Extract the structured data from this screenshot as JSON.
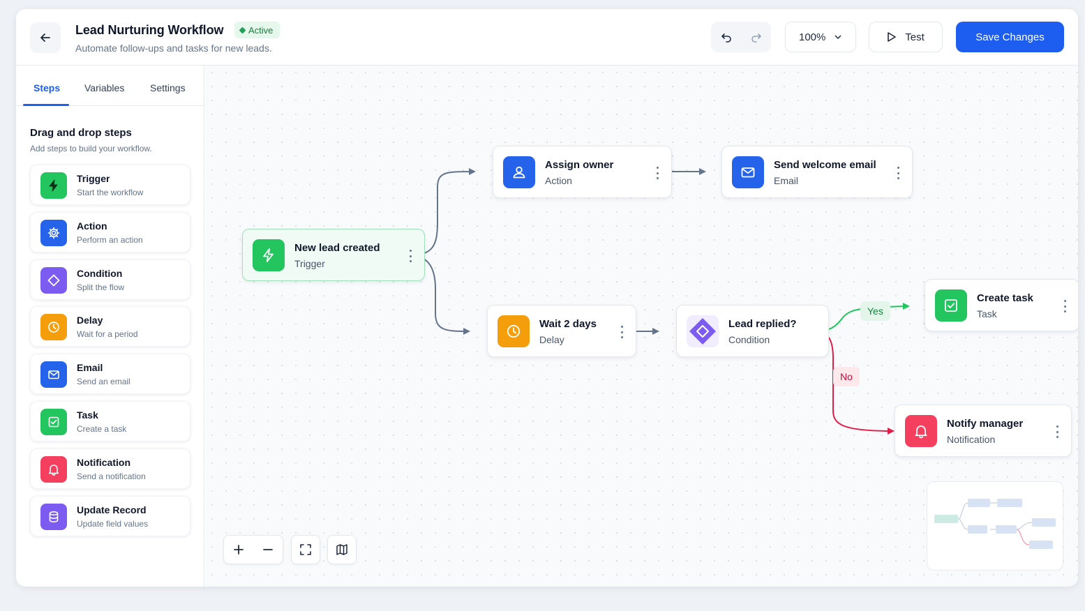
{
  "header": {
    "title": "Lead Nurturing Workflow",
    "status": "Active",
    "subtitle": "Automate follow-ups and tasks for new leads.",
    "zoom": "100%",
    "test_label": "Test",
    "save_label": "Save Changes",
    "icons": [
      "back-arrow-icon",
      "undo-icon",
      "redo-icon",
      "chevron-down-icon",
      "play-icon"
    ]
  },
  "sidebar": {
    "tabs": [
      {
        "label": "Steps",
        "active": true
      },
      {
        "label": "Variables",
        "active": false
      },
      {
        "label": "Settings",
        "active": false
      }
    ],
    "heading": "Drag and drop steps",
    "subheading": "Add steps to build your workflow.",
    "items": [
      {
        "name": "Trigger",
        "desc": "Start the workflow",
        "icon": "lightning-icon",
        "color": "#22c55e"
      },
      {
        "name": "Action",
        "desc": "Perform an action",
        "icon": "gear-icon",
        "color": "#2563eb"
      },
      {
        "name": "Condition",
        "desc": "Split the flow",
        "icon": "diamond-icon",
        "color": "#7c5cf0"
      },
      {
        "name": "Delay",
        "desc": "Wait for a period",
        "icon": "clock-icon",
        "color": "#f59e0b"
      },
      {
        "name": "Email",
        "desc": "Send an email",
        "icon": "mail-icon",
        "color": "#2563eb"
      },
      {
        "name": "Task",
        "desc": "Create a task",
        "icon": "checkbox-icon",
        "color": "#22c55e"
      },
      {
        "name": "Notification",
        "desc": "Send a notification",
        "icon": "bell-icon",
        "color": "#f43f5e"
      },
      {
        "name": "Update Record",
        "desc": "Update field values",
        "icon": "database-icon",
        "color": "#7c5cf0"
      }
    ]
  },
  "canvas": {
    "nodes": {
      "new_lead": {
        "title": "New lead created",
        "type": "Trigger",
        "icon": "lightning-icon",
        "color": "#22c55e"
      },
      "assign_owner": {
        "title": "Assign owner",
        "type": "Action",
        "icon": "user-icon",
        "color": "#2563eb"
      },
      "welcome_email": {
        "title": "Send welcome email",
        "type": "Email",
        "icon": "mail-icon",
        "color": "#2563eb"
      },
      "wait": {
        "title": "Wait 2 days",
        "type": "Delay",
        "icon": "clock-icon",
        "color": "#f59e0b"
      },
      "lead_replied": {
        "title": "Lead replied?",
        "type": "Condition",
        "icon": "diamond-icon",
        "color": "#7c5cf0"
      },
      "create_task": {
        "title": "Create task",
        "type": "Task",
        "icon": "checkbox-icon",
        "color": "#22c55e"
      },
      "notify_manager": {
        "title": "Notify manager",
        "type": "Notification",
        "icon": "bell-icon",
        "color": "#f43f5e"
      }
    },
    "branches": {
      "yes": "Yes",
      "no": "No"
    },
    "controls": [
      "zoom-in-icon",
      "zoom-out-icon",
      "fit-view-icon",
      "map-icon"
    ]
  },
  "colors": {
    "accent": "#1d5ef0",
    "active_green": "#15803d",
    "yes_edge": "#22c55e",
    "no_edge": "#e11d48",
    "edge": "#64748b"
  }
}
